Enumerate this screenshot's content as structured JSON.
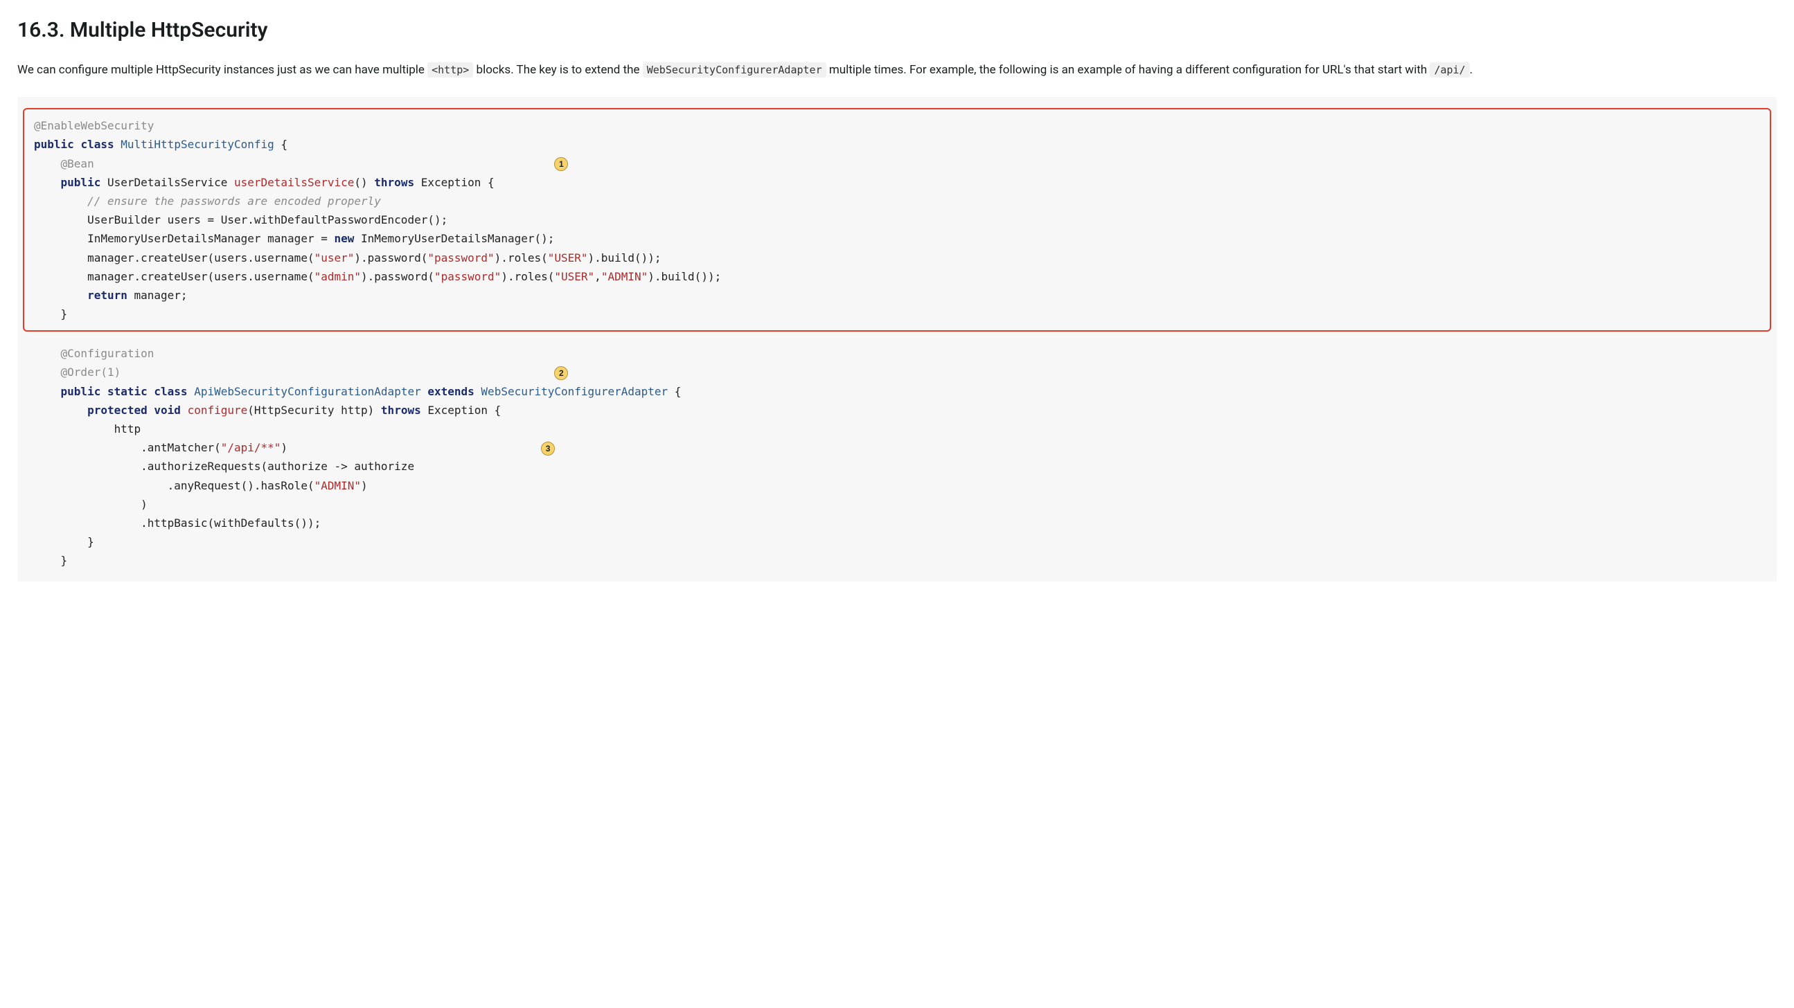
{
  "heading": "16.3. Multiple HttpSecurity",
  "intro": {
    "part1": "We can configure multiple HttpSecurity instances just as we can have multiple ",
    "code1": "<http>",
    "part2": " blocks. The key is to extend the ",
    "code2": "WebSecurityConfigurerAdapter",
    "part3": " multiple times. For example, the following is an example of having a different configuration for URL's that start with ",
    "code3": "/api/",
    "part4": "."
  },
  "callouts": {
    "c1": "1",
    "c2": "2",
    "c3": "3"
  },
  "code": {
    "l1_anno": "@EnableWebSecurity",
    "l2_kw1": "public",
    "l2_kw2": "class",
    "l2_type": "MultiHttpSecurityConfig",
    "l2_brace": " {",
    "l3_anno": "    @Bean",
    "l4_kw1": "    public",
    "l4_type": " UserDetailsService ",
    "l4_fn": "userDetailsService",
    "l4_paren": "() ",
    "l4_kw2": "throws",
    "l4_rest": " Exception {",
    "l5_comment": "        // ensure the passwords are encoded properly",
    "l6": "        UserBuilder users = User.withDefaultPasswordEncoder();",
    "l7a": "        InMemoryUserDetailsManager manager = ",
    "l7_kw": "new",
    "l7b": " InMemoryUserDetailsManager();",
    "l8a": "        manager.createUser(users.username(",
    "l8s1": "\"user\"",
    "l8b": ").password(",
    "l8s2": "\"password\"",
    "l8c": ").roles(",
    "l8s3": "\"USER\"",
    "l8d": ").build());",
    "l9a": "        manager.createUser(users.username(",
    "l9s1": "\"admin\"",
    "l9b": ").password(",
    "l9s2": "\"password\"",
    "l9c": ").roles(",
    "l9s3": "\"USER\"",
    "l9comma": ",",
    "l9s4": "\"ADMIN\"",
    "l9d": ").build());",
    "l10_kw": "        return",
    "l10_rest": " manager;",
    "l11": "    }",
    "r1_anno": "    @Configuration",
    "r2_anno": "    @Order(1)",
    "r3_kw1": "    public",
    "r3_kw2": " static",
    "r3_kw3": " class ",
    "r3_type1": "ApiWebSecurityConfigurationAdapter",
    "r3_kw4": " extends ",
    "r3_type2": "WebSecurityConfigurerAdapter",
    "r3_brace": " {",
    "r4_kw1": "        protected",
    "r4_kw2": " void ",
    "r4_fn": "configure",
    "r4_paren": "(HttpSecurity http) ",
    "r4_kw3": "throws",
    "r4_rest": " Exception {",
    "r5": "            http",
    "r6a": "                .antMatcher(",
    "r6s": "\"/api/**\"",
    "r6b": ")",
    "r7": "                .authorizeRequests(authorize -> authorize",
    "r8a": "                    .anyRequest().hasRole(",
    "r8s": "\"ADMIN\"",
    "r8b": ")",
    "r9": "                )",
    "r10": "                .httpBasic(withDefaults());",
    "r11": "        }",
    "r12": "    }"
  }
}
